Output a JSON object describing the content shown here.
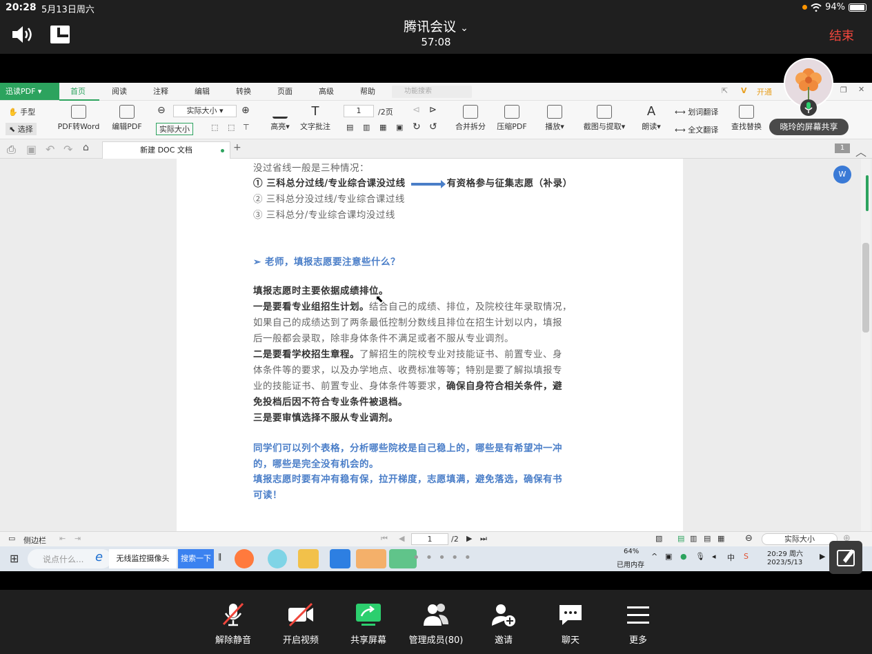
{
  "status_bar": {
    "time": "20:28",
    "date": "5月13日周六",
    "battery": "94%"
  },
  "meeting": {
    "title": "腾讯会议",
    "elapsed": "57:08",
    "end_label": "结束",
    "sharer_label": "晓玲的屏幕共享"
  },
  "pdf_app": {
    "brand": "迅读PDF",
    "tabs": [
      "首页",
      "阅读",
      "注释",
      "编辑",
      "转换",
      "页面",
      "高级",
      "帮助"
    ],
    "search_placeholder": "功能搜索",
    "vip_label": "开通",
    "toolbar": {
      "hand": "手型",
      "select": "选择",
      "pdf_to_word": "PDF转Word",
      "edit_pdf": "编辑PDF",
      "zoom_value": "实际大小",
      "actual_size": "实际大小",
      "highlight": "高亮",
      "text_note": "文字批注",
      "page_input": "1",
      "page_total": "/2页",
      "merge_split": "合并拆分",
      "compress": "压缩PDF",
      "play": "播放",
      "screenshot_extract": "截图与提取",
      "read_aloud": "朗读",
      "word_translate": "划词翻译",
      "full_translate": "全文翻译",
      "find_replace": "查找替换"
    },
    "doc_tab": "新建 DOC 文档",
    "page_badge": "1",
    "bottom": {
      "sidebar": "侧边栏",
      "page_input": "1",
      "page_total": "/2",
      "zoom": "实际大小"
    }
  },
  "document": {
    "intro": "没过省线一般是三种情况：",
    "case1_left": "① 三科总分过线/专业综合课没过线",
    "case1_right": "有资格参与征集志愿（补录）",
    "case2": "② 三科总分没过线/专业综合课过线",
    "case3": "③ 三科总分/专业综合课均没过线",
    "question": "➢  老师，填报志愿要注意些什么？",
    "p1": "填报志愿时主要依据成绩排位。",
    "p2_bold": "一是要看专业组招生计划。",
    "p2_rest": "结合自己的成绩、排位，及院校往年录取情况，",
    "p3": "如果自己的成绩达到了两条最低控制分数线且排位在招生计划以内，填报",
    "p4": "后一般都会录取，除非身体条件不满足或者不服从专业调剂。",
    "p5_bold": "二是要看学校招生章程。",
    "p5_rest": "了解招生的院校专业对技能证书、前置专业、身",
    "p6": "体条件等的要求，以及办学地点、收费标准等等；特别是要了解拟填报专",
    "p7_rest": "业的技能证书、前置专业、身体条件等要求，",
    "p7_bold": "确保自身符合相关条件，避",
    "p8": "免投档后因不符合专业条件被退档。",
    "p9": "三是要审慎选择不服从专业调剂。",
    "b1": "同学们可以列个表格，分析哪些院校是自己稳上的，哪些是有希望冲一冲",
    "b2": "的，哪些是完全没有机会的。",
    "b3": "填报志愿时要有冲有稳有保，拉开梯度，志愿填满，避免落选，确保有书",
    "b4": "可读！"
  },
  "taskbar": {
    "search_hint": "说点什么...",
    "ie_item": "无线监控摄像头",
    "search_btn": "搜索一下",
    "memory_pct": "64%",
    "memory_label": "已用内存",
    "clock_time": "20:29 周六",
    "clock_date": "2023/5/13"
  },
  "controls": {
    "unmute": "解除静音",
    "video": "开启视频",
    "share": "共享屏幕",
    "members": "管理成员(80)",
    "invite": "邀请",
    "chat": "聊天",
    "more": "更多"
  },
  "colors": {
    "accent_green": "#2ca35e",
    "end_red": "#f0463c",
    "doc_blue": "#4a7ec8"
  }
}
